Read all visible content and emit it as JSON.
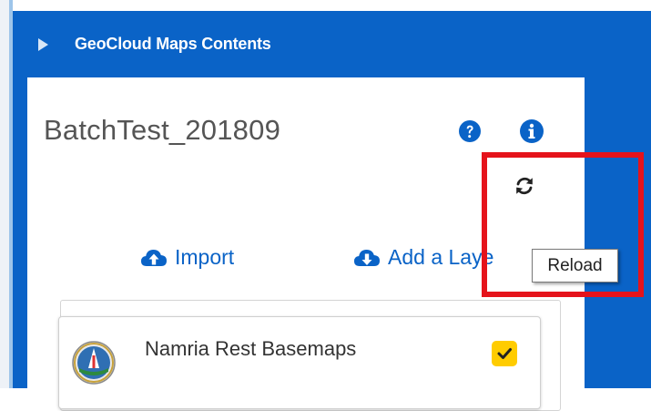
{
  "header": {
    "title": "GeoCloud Maps Contents"
  },
  "project": {
    "title": "BatchTest_201809"
  },
  "icons": {
    "help": "question-circle-icon",
    "info": "info-circle-icon",
    "reload": "sync-icon"
  },
  "actions": {
    "import_label": "Import",
    "add_layer_label": "Add a Laye"
  },
  "tooltip": {
    "text": "Reload"
  },
  "layers": [
    {
      "name": "Namria Rest Basemaps",
      "checked": true
    }
  ],
  "colors": {
    "header_blue": "#0a63c7",
    "highlight_red": "#e5131b",
    "checkbox_yellow": "#ffcc00"
  }
}
